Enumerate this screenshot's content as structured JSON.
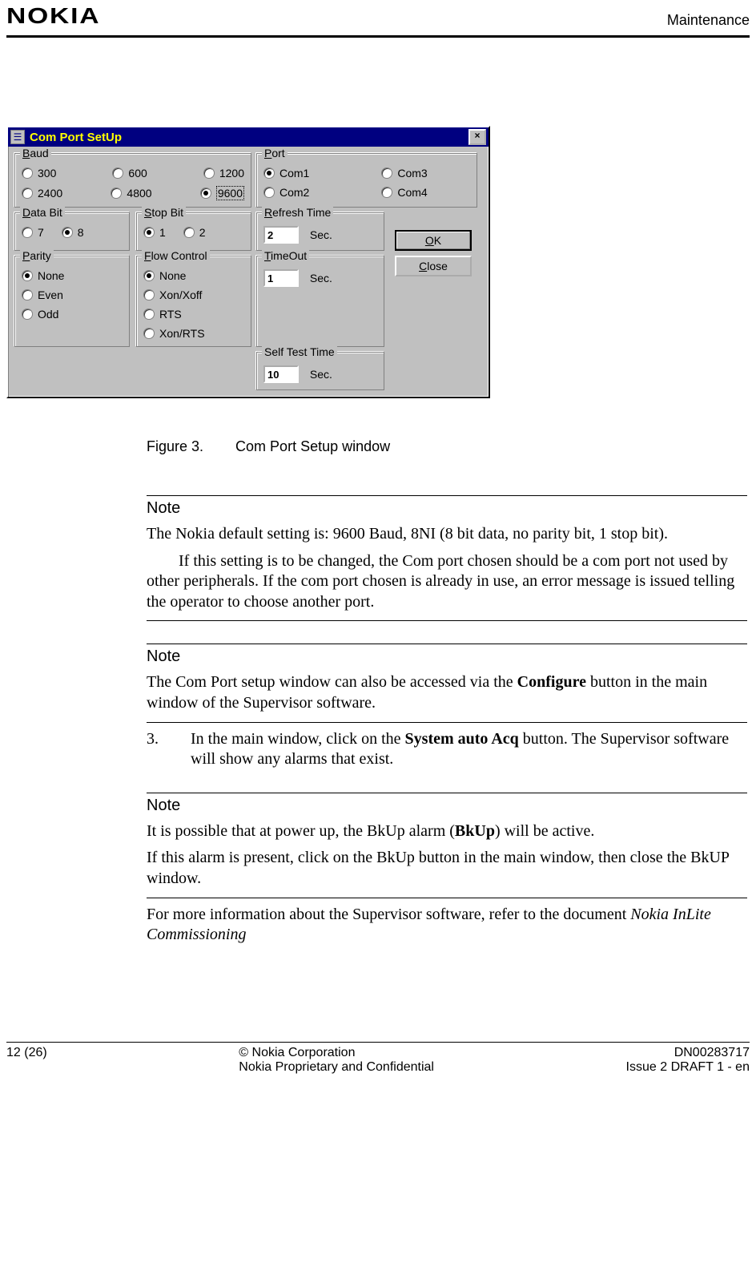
{
  "header": {
    "brand": "NOKIA",
    "section": "Maintenance"
  },
  "dialog": {
    "title": "Com Port SetUp",
    "close_glyph": "×",
    "baud": {
      "legend_pre": "B",
      "legend_rest": "aud",
      "options": [
        "300",
        "600",
        "1200",
        "2400",
        "4800",
        "9600"
      ],
      "selected": "9600"
    },
    "port": {
      "legend_pre": "P",
      "legend_rest": "ort",
      "options_left": [
        "Com1",
        "Com2"
      ],
      "options_right": [
        "Com3",
        "Com4"
      ],
      "selected": "Com1"
    },
    "databit": {
      "legend_pre": "D",
      "legend_rest": "ata Bit",
      "options": [
        "7",
        "8"
      ],
      "selected": "8"
    },
    "stopbit": {
      "legend_pre": "S",
      "legend_rest": "top Bit",
      "options": [
        "1",
        "2"
      ],
      "selected": "1"
    },
    "parity": {
      "legend_pre": "P",
      "legend_rest": "arity",
      "options": [
        "None",
        "Even",
        "Odd"
      ],
      "selected": "None"
    },
    "flow": {
      "legend_pre": "F",
      "legend_rest": "low Control",
      "options": [
        "None",
        "Xon/Xoff",
        "RTS",
        "Xon/RTS"
      ],
      "selected": "None"
    },
    "refresh": {
      "legend_pre": "R",
      "legend_rest": "efresh Time",
      "value": "2",
      "unit": "Sec."
    },
    "timeout": {
      "legend_pre": "T",
      "legend_rest": "imeOut",
      "value": "1",
      "unit": "Sec."
    },
    "selftest": {
      "legend_plain": "Self Test Time",
      "value": "10",
      "unit": "Sec."
    },
    "ok_pre": "O",
    "ok_rest": "K",
    "close_pre": "C",
    "close_rest": "lose"
  },
  "caption": {
    "label": "Figure 3.",
    "text": "Com Port Setup window"
  },
  "notes": {
    "n1_head": "Note",
    "n1_p1": "The Nokia default setting is: 9600 Baud, 8NI (8 bit data, no parity bit, 1 stop bit).",
    "n1_p2": "If this setting is to be changed, the Com port chosen should be a com port not used by other peripherals. If the com port chosen is already in use, an error message is issued telling the operator to choose another port.",
    "n2_head": "Note",
    "n2_p1a": "The Com Port setup window can also be accessed via the ",
    "n2_p1b": "Configure",
    "n2_p1c": " button in the main window of the Supervisor software.",
    "step_num": "3.",
    "step_a": "In the main window, click on the ",
    "step_b": "System auto Acq",
    "step_c": " button. The Supervisor software will show any alarms that exist.",
    "n3_head": "Note",
    "n3_p1a": "It is possible that at power up, the BkUp alarm (",
    "n3_p1b": "BkUp",
    "n3_p1c": ") will be active.",
    "n3_p2": "If this alarm is present, click on the BkUp button in the main window, then close the BkUP window.",
    "tail_a": "For more information about the Supervisor software, refer to the document ",
    "tail_b": "Nokia InLite Commissioning"
  },
  "footer": {
    "page": "12 (26)",
    "mid1": "© Nokia Corporation",
    "mid2": "Nokia Proprietary and Confidential",
    "right1": "DN00283717",
    "right2": "Issue 2 DRAFT 1 - en"
  }
}
